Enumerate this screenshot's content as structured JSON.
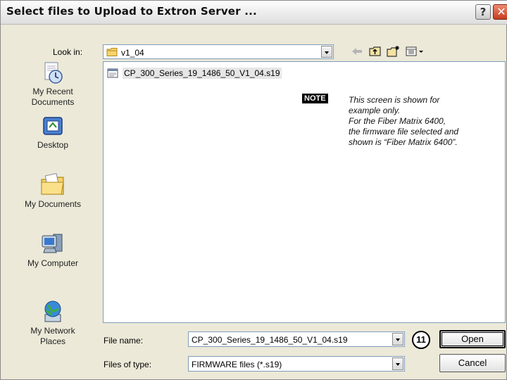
{
  "window": {
    "title": "Select files to Upload to Extron Server ...",
    "help_label": "?",
    "close_label": "✕"
  },
  "look_in": {
    "label": "Look in:",
    "value": "v1_04"
  },
  "toolbar": {
    "icons": [
      "back-arrow-icon",
      "up-folder-icon",
      "new-folder-icon",
      "view-menu-icon"
    ]
  },
  "places": [
    {
      "id": "recent",
      "label_line1": "My Recent",
      "label_line2": "Documents"
    },
    {
      "id": "desktop",
      "label_line1": "Desktop",
      "label_line2": ""
    },
    {
      "id": "documents",
      "label_line1": "My Documents",
      "label_line2": ""
    },
    {
      "id": "computer",
      "label_line1": "My Computer",
      "label_line2": ""
    },
    {
      "id": "network",
      "label_line1": "My Network",
      "label_line2": "Places"
    }
  ],
  "files": [
    {
      "name": "CP_300_Series_19_1486_50_V1_04.s19"
    }
  ],
  "note": {
    "badge": "NOTE",
    "line1": "This screen is shown for",
    "line2": "example only.",
    "line3": "For the Fiber Matrix 6400,",
    "line4": "the firmware file selected and",
    "line5": "shown is “Fiber Matrix 6400”."
  },
  "file_name": {
    "label": "File name:",
    "value": "CP_300_Series_19_1486_50_V1_04.s19"
  },
  "file_type": {
    "label": "Files of type:",
    "value": "FIRMWARE files (*.s19)"
  },
  "buttons": {
    "open": "Open",
    "cancel": "Cancel"
  },
  "callout": "11",
  "colors": {
    "dialog_bg": "#ece9d8",
    "close_button": "#c43d1e",
    "combo_border": "#7f9db9"
  }
}
